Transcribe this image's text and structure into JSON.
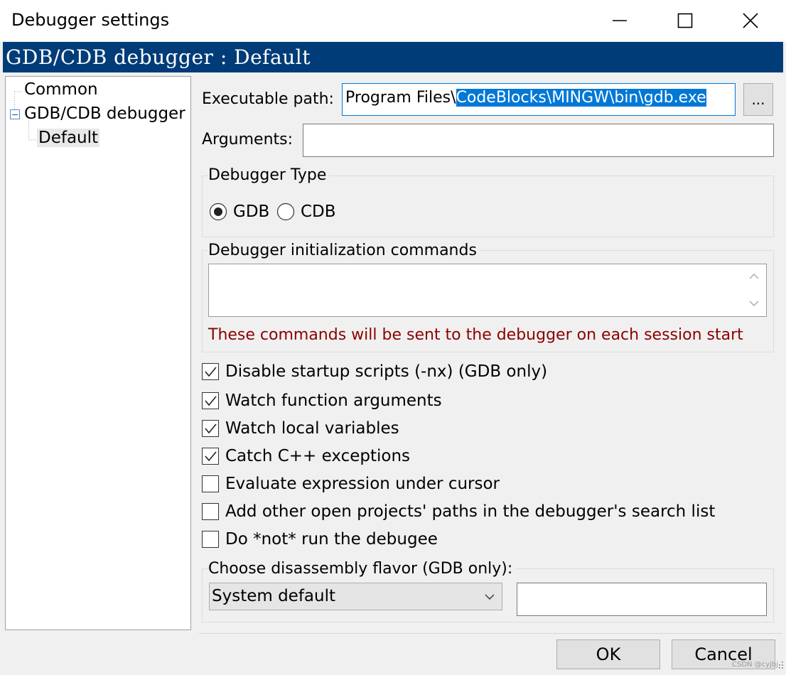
{
  "window": {
    "title": "Debugger settings",
    "minimize_label": "minimize",
    "maximize_label": "maximize",
    "close_label": "close"
  },
  "banner": {
    "text": "GDB/CDB debugger : Default"
  },
  "tree": {
    "items": [
      {
        "label": "Common"
      },
      {
        "label": "GDB/CDB debugger"
      },
      {
        "label": "Default"
      }
    ]
  },
  "form": {
    "executable_label": "Executable path:",
    "executable_visible_prefix": "Program Files\\",
    "executable_selected": "CodeBlocks\\MINGW\\bin\\gdb.exe",
    "browse_label": "...",
    "arguments_label": "Arguments:",
    "arguments_value": "",
    "debugger_type": {
      "title": "Debugger Type",
      "options": [
        "GDB",
        "CDB"
      ],
      "selected": "GDB"
    },
    "init_commands": {
      "title": "Debugger initialization commands",
      "value": "",
      "note": "These commands will be sent to the debugger on each session start"
    },
    "checkboxes": [
      {
        "label": "Disable startup scripts (-nx) (GDB only)",
        "checked": true
      },
      {
        "label": "Watch function arguments",
        "checked": true
      },
      {
        "label": "Watch local variables",
        "checked": true
      },
      {
        "label": "Catch C++ exceptions",
        "checked": true
      },
      {
        "label": "Evaluate expression under cursor",
        "checked": false
      },
      {
        "label": "Add other open projects' paths in the debugger's search list",
        "checked": false
      },
      {
        "label": "Do *not* run the debugee",
        "checked": false
      }
    ],
    "disassembly": {
      "title": "Choose disassembly flavor (GDB only):",
      "selected": "System default",
      "custom_value": ""
    }
  },
  "buttons": {
    "ok": "OK",
    "cancel": "Cancel"
  },
  "watermark": "CSDN @cyjbj",
  "colors": {
    "banner_bg": "#003c78",
    "selection_bg": "#0078d7",
    "note_text": "#8b0000"
  }
}
